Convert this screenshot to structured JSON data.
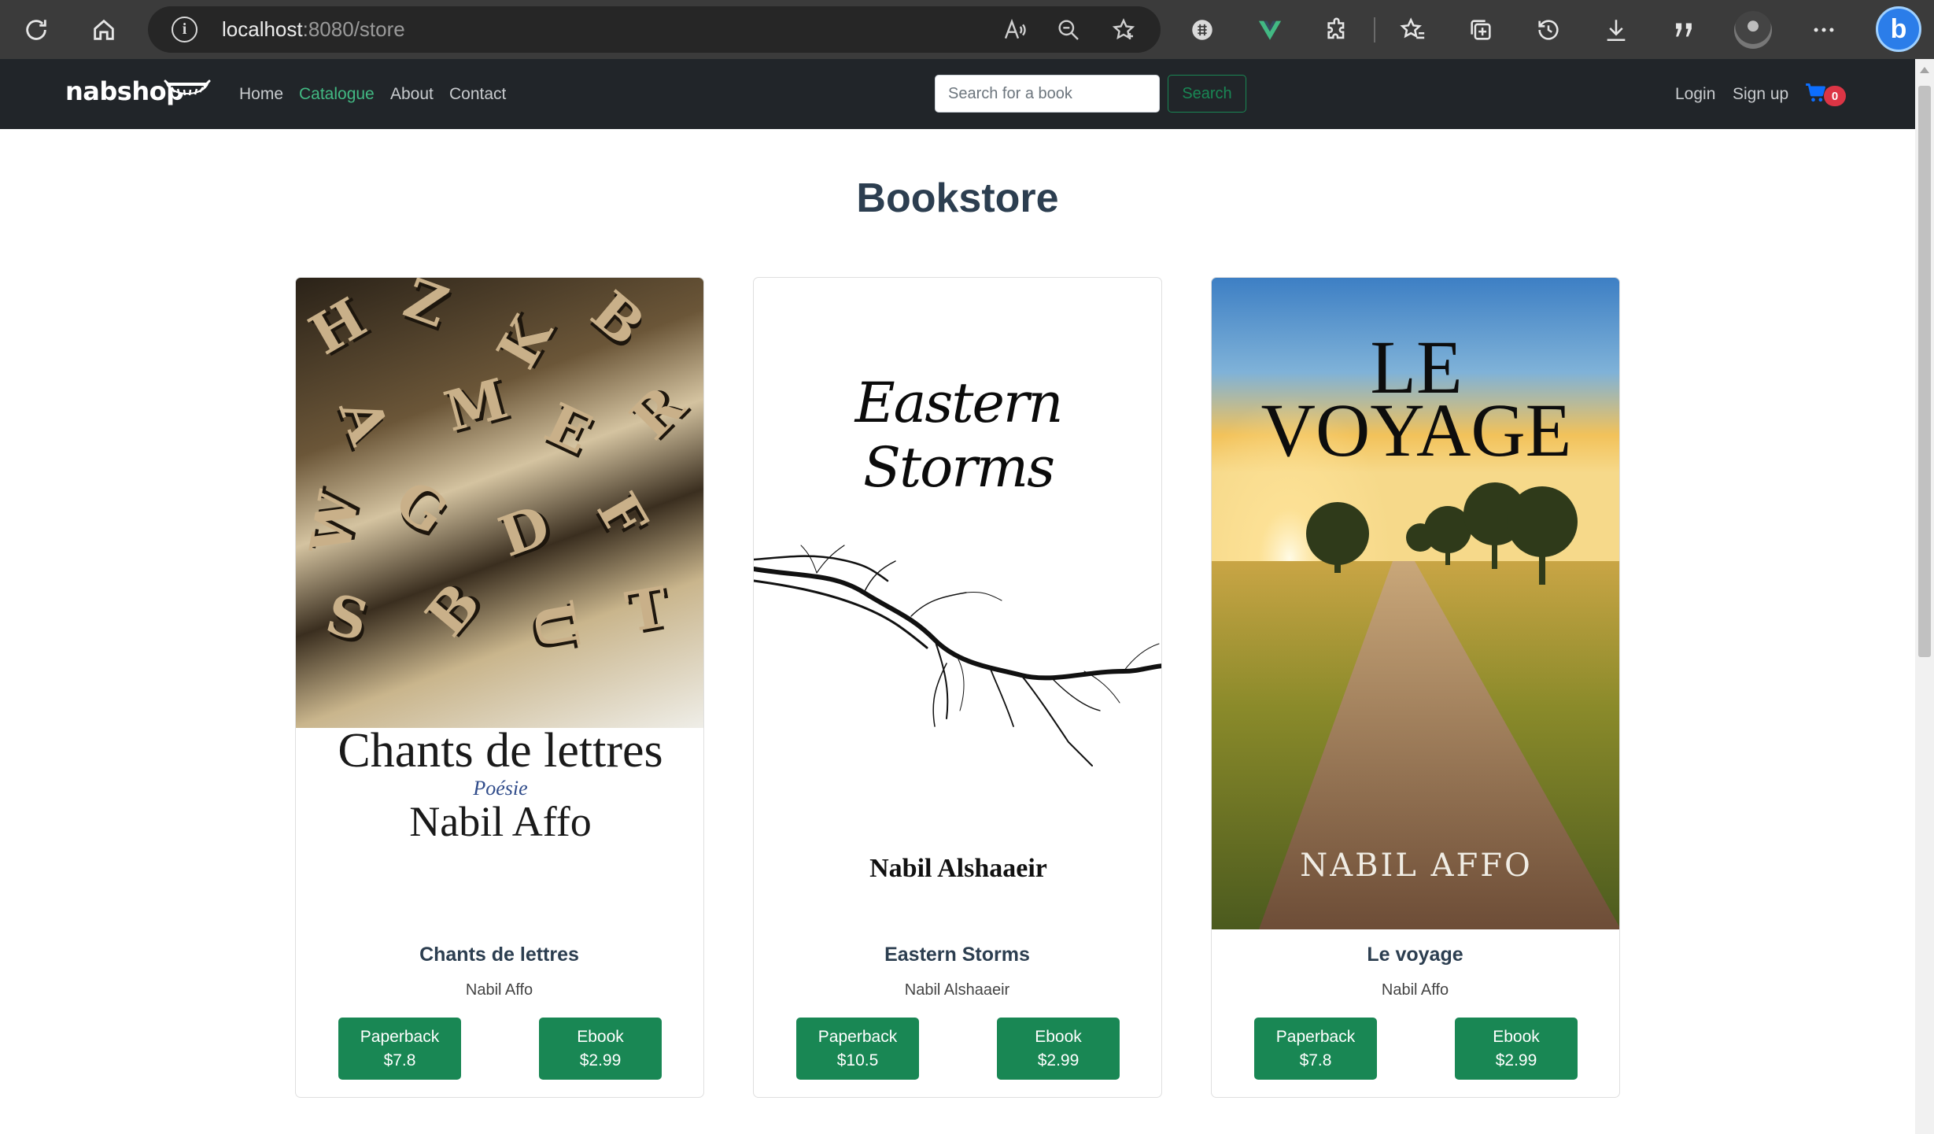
{
  "browser": {
    "url_host": "localhost",
    "url_path": ":8080/store",
    "icons": [
      "refresh-icon",
      "home-icon",
      "site-info-icon",
      "read-aloud-icon",
      "zoom-out-icon",
      "add-favorite-icon",
      "extension-icon",
      "vue-devtools-icon",
      "extensions-icon",
      "favorites-icon",
      "collections-icon",
      "history-icon",
      "downloads-icon",
      "quote-icon",
      "profile-avatar",
      "more-icon",
      "bing-icon"
    ]
  },
  "navbar": {
    "brand": "nabshop",
    "links": [
      {
        "label": "Home"
      },
      {
        "label": "Catalogue",
        "active": true
      },
      {
        "label": "About"
      },
      {
        "label": "Contact"
      }
    ],
    "search_placeholder": "Search for a book",
    "search_button": "Search",
    "login": "Login",
    "signup": "Sign up",
    "cart_count": "0",
    "accent_color": "#42b983",
    "button_color": "#198754",
    "badge_color": "#dc3545"
  },
  "page": {
    "title": "Bookstore"
  },
  "books": [
    {
      "title": "Chants de lettres",
      "author": "Nabil Affo",
      "cover": {
        "title": "Chants de lettres",
        "subtitle": "Poésie",
        "author": "Nabil Affo"
      },
      "paperback_label": "Paperback",
      "paperback_price": "$7.8",
      "ebook_label": "Ebook",
      "ebook_price": "$2.99"
    },
    {
      "title": "Eastern Storms",
      "author": "Nabil Alshaaeir",
      "cover": {
        "title": "Eastern Storms",
        "author": "Nabil Alshaaeir"
      },
      "paperback_label": "Paperback",
      "paperback_price": "$10.5",
      "ebook_label": "Ebook",
      "ebook_price": "$2.99"
    },
    {
      "title": "Le voyage",
      "author": "Nabil Affo",
      "cover": {
        "title_line1": "LE",
        "title_line2": "VOYAGE",
        "author": "NABIL AFFO"
      },
      "paperback_label": "Paperback",
      "paperback_price": "$7.8",
      "ebook_label": "Ebook",
      "ebook_price": "$2.99"
    }
  ]
}
